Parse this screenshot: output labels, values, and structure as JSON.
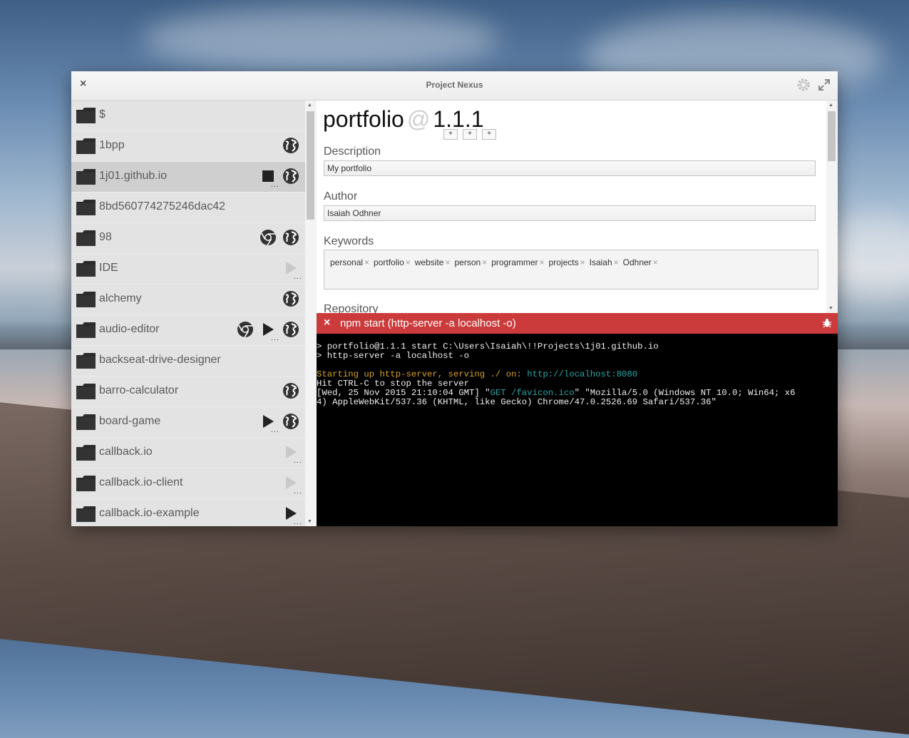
{
  "window": {
    "title": "Project Nexus",
    "close_glyph": "×"
  },
  "projects": [
    {
      "name": "$",
      "actions": []
    },
    {
      "name": "1bpp",
      "actions": [
        "globe"
      ]
    },
    {
      "name": "1j01.github.io",
      "actions": [
        "stop",
        "globe"
      ],
      "selected": true
    },
    {
      "name": "8bd560774275246dac42",
      "actions": []
    },
    {
      "name": "98",
      "actions": [
        "chrome",
        "globe"
      ]
    },
    {
      "name": "IDE",
      "actions": [
        "play-disabled"
      ]
    },
    {
      "name": "alchemy",
      "actions": [
        "globe"
      ]
    },
    {
      "name": "audio-editor",
      "actions": [
        "chrome",
        "play",
        "globe"
      ]
    },
    {
      "name": "backseat-drive-designer",
      "actions": []
    },
    {
      "name": "barro-calculator",
      "actions": [
        "globe"
      ]
    },
    {
      "name": "board-game",
      "actions": [
        "play",
        "globe"
      ]
    },
    {
      "name": "callback.io",
      "actions": [
        "play-disabled"
      ]
    },
    {
      "name": "callback.io-client",
      "actions": [
        "play-disabled"
      ]
    },
    {
      "name": "callback.io-example",
      "actions": [
        "play"
      ]
    },
    {
      "name": "",
      "actions": []
    }
  ],
  "package": {
    "name": "portfolio",
    "at": "@",
    "version": "1.1.1",
    "version_buttons": [
      "+",
      "+",
      "+"
    ],
    "description_label": "Description",
    "description": "My portfolio",
    "author_label": "Author",
    "author": "Isaiah Odhner",
    "keywords_label": "Keywords",
    "keywords": [
      "personal",
      "portfolio",
      "website",
      "person",
      "programmer",
      "projects",
      "Isaiah",
      "Odhner"
    ],
    "keyword_remove": "×",
    "repository_label": "Repository"
  },
  "terminal": {
    "close_glyph": "×",
    "title": "npm start (http-server -a localhost -o)",
    "lines": {
      "l1": "> portfolio@1.1.1 start C:\\Users\\Isaiah\\!!Projects\\1j01.github.io",
      "l2": "> http-server -a localhost -o",
      "l3a": "Starting up http-server, serving ./ on: ",
      "l3b": "http://localhost:8080",
      "l4": "Hit CTRL-C to stop the server",
      "l5a": "[Wed, 25 Nov 2015 21:10:04 GMT] \"",
      "l5b": "GET /favicon.ico",
      "l5c": "\" \"Mozilla/5.0 (Windows NT 10.0; Win64; x6",
      "l6": "4) AppleWebKit/537.36 (KHTML, like Gecko) Chrome/47.0.2526.69 Safari/537.36\""
    }
  },
  "colors": {
    "terminal_bar": "#cc3b3b",
    "terminal_bg": "#000000",
    "sidebar_bg": "#e3e3e3",
    "selected_row": "#cfcfcf"
  }
}
